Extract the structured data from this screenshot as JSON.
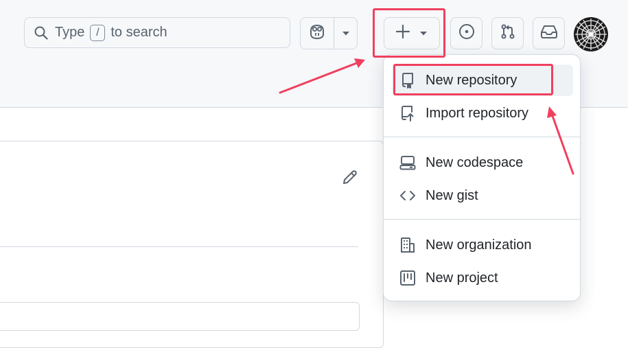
{
  "search": {
    "prefix": "Type",
    "key": "/",
    "suffix": "to search"
  },
  "toolbar": {
    "create_icon": "plus-icon",
    "issues_icon": "issue-opened-icon",
    "pulls_icon": "git-pull-request-icon",
    "inbox_icon": "inbox-icon",
    "copilot_icon": "copilot-icon"
  },
  "create_menu": {
    "items": [
      {
        "label": "New repository",
        "icon": "repo-icon"
      },
      {
        "label": "Import repository",
        "icon": "repo-push-icon"
      },
      {
        "label": "New codespace",
        "icon": "codespaces-icon"
      },
      {
        "label": "New gist",
        "icon": "code-icon"
      },
      {
        "label": "New organization",
        "icon": "organization-icon"
      },
      {
        "label": "New project",
        "icon": "project-icon"
      }
    ]
  },
  "colors": {
    "highlight": "#f0405e",
    "header_bg": "#f6f8fa",
    "border": "#d1d9e0"
  }
}
